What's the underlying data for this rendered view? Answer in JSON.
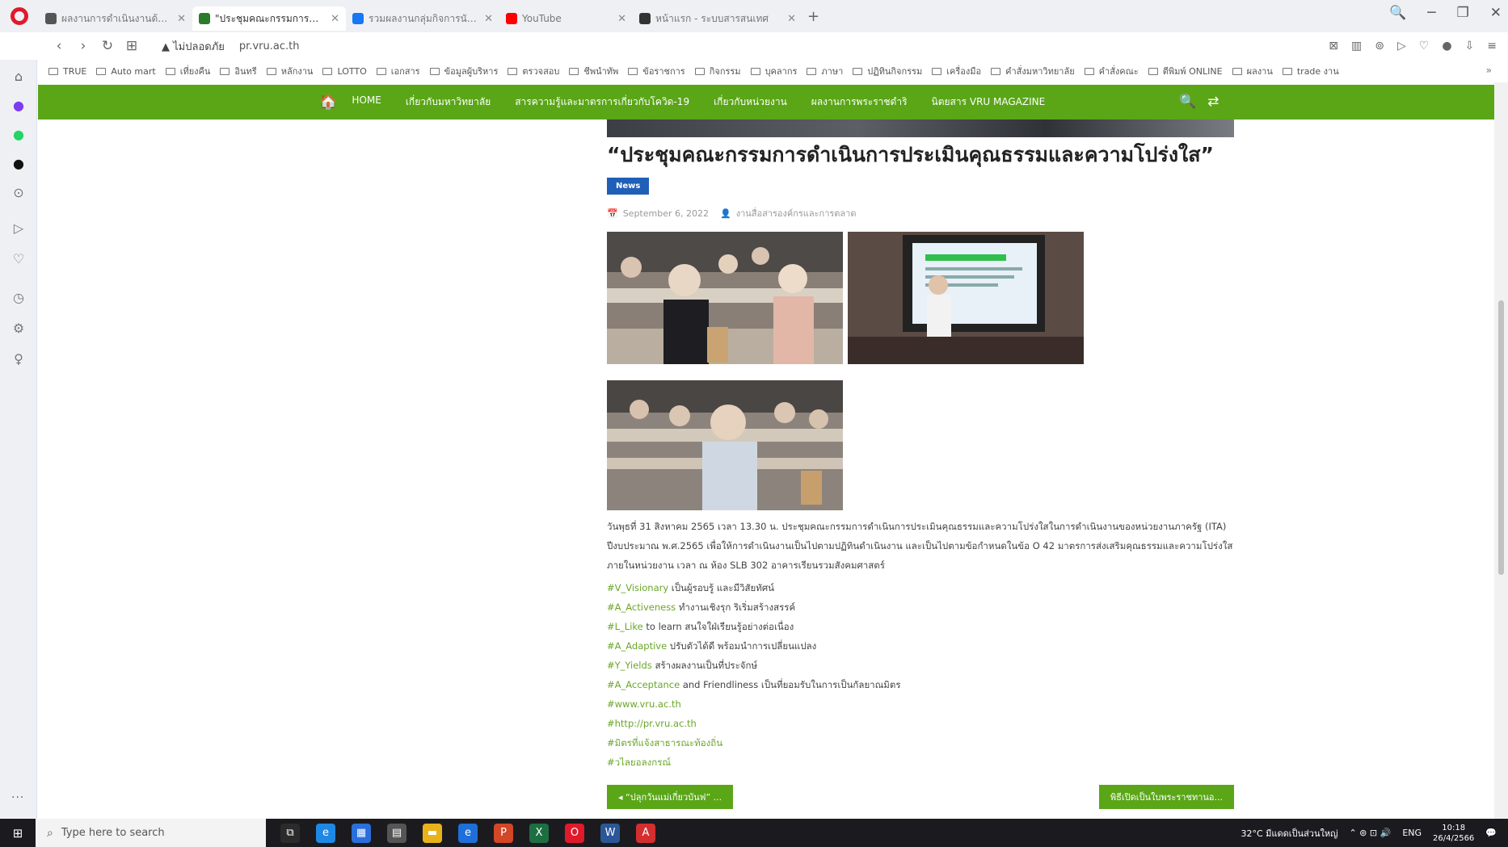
{
  "browser": {
    "tabs": [
      {
        "label": "ผลงานการดำเนินงานด้านพัฒนาคุณภาพ",
        "favicon_color": "#555555",
        "active": false
      },
      {
        "label": "\"ประชุมคณะกรรมการดำเนินการประเมินคุณธรรม",
        "favicon_color": "#2b7b2b",
        "active": true
      },
      {
        "label": "รวมผลงานกลุ่มกิจการนักศึกษา",
        "favicon_color": "#1877f2",
        "active": false
      },
      {
        "label": "YouTube",
        "favicon_color": "#ff0000",
        "active": false
      },
      {
        "label": "หน้าแรก - ระบบสารสนเทศ",
        "favicon_color": "#333333",
        "active": false
      }
    ],
    "new_tab": "+",
    "window_controls": [
      "🔍",
      "─",
      "❐",
      "✕"
    ],
    "address": {
      "status": "▲ ไม่ปลอดภัย",
      "url": "pr.vru.ac.th",
      "right_icons": [
        "⊠",
        "▥",
        "⊚",
        "▷",
        "♡",
        "●",
        "⇩",
        "≡"
      ]
    },
    "bookmarks": [
      "TRUE",
      "Auto mart",
      "เที่ยงคืน",
      "อินทรี",
      "หลักงาน",
      "LOTTO",
      "เอกสาร",
      "ข้อมูลผู้บริหาร",
      "ตรวจสอบ",
      "ชีพนำทัพ",
      "ข้อราชการ",
      "กิจกรรม",
      "บุคลากร",
      "ภาษา",
      "ปฏิทินกิจกรรม",
      "เครื่องมือ",
      "คำสั่งมหาวิทยาลัย",
      "คำสั่งคณะ",
      "ตีพิมพ์ ONLINE",
      "ผลงาน",
      "trade งาน"
    ],
    "bookmarks_more": "»"
  },
  "sidebar_icons": [
    {
      "name": "home-icon",
      "glyph": "⌂",
      "color": "#666666"
    },
    {
      "name": "messenger-icon",
      "glyph": "●",
      "color": "#7b3cf2"
    },
    {
      "name": "whatsapp-icon",
      "glyph": "●",
      "color": "#25d366"
    },
    {
      "name": "tiktok-icon",
      "glyph": "●",
      "color": "#111111"
    },
    {
      "name": "player-icon",
      "glyph": "⊙",
      "color": "#777777"
    },
    {
      "name": "send-icon",
      "glyph": "▷",
      "color": "#777777"
    },
    {
      "name": "heart-icon",
      "glyph": "♡",
      "color": "#777777"
    },
    {
      "name": "history-icon",
      "glyph": "◷",
      "color": "#777777"
    },
    {
      "name": "extensions-icon",
      "glyph": "⚙",
      "color": "#777777"
    },
    {
      "name": "idea-icon",
      "glyph": "♀",
      "color": "#777777"
    }
  ],
  "sidebar_more": "···",
  "site_nav": {
    "home": "🏠",
    "items": [
      "HOME",
      "เกี่ยวกับมหาวิทยาลัย",
      "สารความรู้และมาตรการเกี่ยวกับโควิด-19",
      "เกี่ยวกับหน่วยงาน",
      "ผลงานการพระราชดำริ",
      "นิตยสาร VRU MAGAZINE"
    ],
    "search_icon": "🔍",
    "random_icon": "⇄"
  },
  "article": {
    "title": "“ประชุมคณะกรรมการดำเนินการประเมินคุณธรรมและความโปร่งใส”",
    "category": "News",
    "date_icon": "📅",
    "date": "September 6, 2022",
    "author_icon": "👤",
    "author": "งานสื่อสารองค์กรและการตลาด",
    "body": "วันพุธที่ 31 สิงหาคม 2565 เวลา 13.30 น. ประชุมคณะกรรมการดำเนินการประเมินคุณธรรมและความโปร่งใสในการดำเนินงานของหน่วยงานภาครัฐ (ITA) ปีงบประมาณ พ.ศ.2565 เพื่อให้การดำเนินงานเป็นไปตามปฏิทินดำเนินงาน และเป็นไปตามข้อกำหนดในข้อ O 42 มาตรการส่งเสริมคุณธรรมและความโปร่งใสภายในหน่วยงาน เวลา ณ ห้อง SLB 302 อาคารเรียนรวมสังคมศาสตร์",
    "tags": [
      {
        "hash": "#V_Visionary",
        "rest": " เป็นผู้รอบรู้ และมีวิสัยทัศน์"
      },
      {
        "hash": "#A_Activeness",
        "rest": " ทำงานเชิงรุก ริเริ่มสร้างสรรค์"
      },
      {
        "hash": "#L_Like",
        "rest": " to learn สนใจใฝ่เรียนรู้อย่างต่อเนื่อง"
      },
      {
        "hash": "#A_Adaptive",
        "rest": " ปรับตัวได้ดี พร้อมนำการเปลี่ยนแปลง"
      },
      {
        "hash": "#Y_Yields",
        "rest": " สร้างผลงานเป็นที่ประจักษ์"
      },
      {
        "hash": "#A_Acceptance",
        "rest": " and Friendliness เป็นที่ยอมรับในการเป็นกัลยาณมิตร"
      },
      {
        "hash": "#www.vru.ac.th",
        "rest": ""
      },
      {
        "hash": "#http://pr.vru.ac.th",
        "rest": ""
      },
      {
        "hash": "#มิตรที่แจ้งสาธารณะท้องถิ่น",
        "rest": ""
      },
      {
        "hash": "#วไลยอลงกรณ์",
        "rest": ""
      }
    ]
  },
  "post_nav": {
    "prev": "◂ “ปลุกวันแม่เกี่ยวบันฟ” ...",
    "next": "พิธีเปิดเป็นใบพระราชทานอ..."
  },
  "taskbar": {
    "start": "⊞",
    "search_placeholder": "Type here to search",
    "search_icon": "⌕",
    "apps": [
      {
        "name": "task-view-icon",
        "glyph": "⧉",
        "color": "#2b2b2b"
      },
      {
        "name": "edge-icon",
        "glyph": "e",
        "color": "#1e88e5"
      },
      {
        "name": "store-icon",
        "glyph": "▦",
        "color": "#2a6fdb"
      },
      {
        "name": "calculator-icon",
        "glyph": "▤",
        "color": "#555555"
      },
      {
        "name": "file-explorer-icon",
        "glyph": "▬",
        "color": "#e8b31a"
      },
      {
        "name": "ie-icon",
        "glyph": "e",
        "color": "#1e6fd9"
      },
      {
        "name": "powerpoint-icon",
        "glyph": "P",
        "color": "#d24726"
      },
      {
        "name": "excel-icon",
        "glyph": "X",
        "color": "#1d6f42"
      },
      {
        "name": "opera-icon",
        "glyph": "O",
        "color": "#e01a2b"
      },
      {
        "name": "word-icon",
        "glyph": "W",
        "color": "#2b5797"
      },
      {
        "name": "acrobat-icon",
        "glyph": "A",
        "color": "#d32f2f"
      }
    ],
    "weather": "32°C มีแดดเป็นส่วนใหญ่",
    "tray_icons": "⌃ ⊚ ⊡ 🔊",
    "language": "ENG",
    "time": "10:18",
    "date": "26/4/2566",
    "notification": "💬"
  }
}
